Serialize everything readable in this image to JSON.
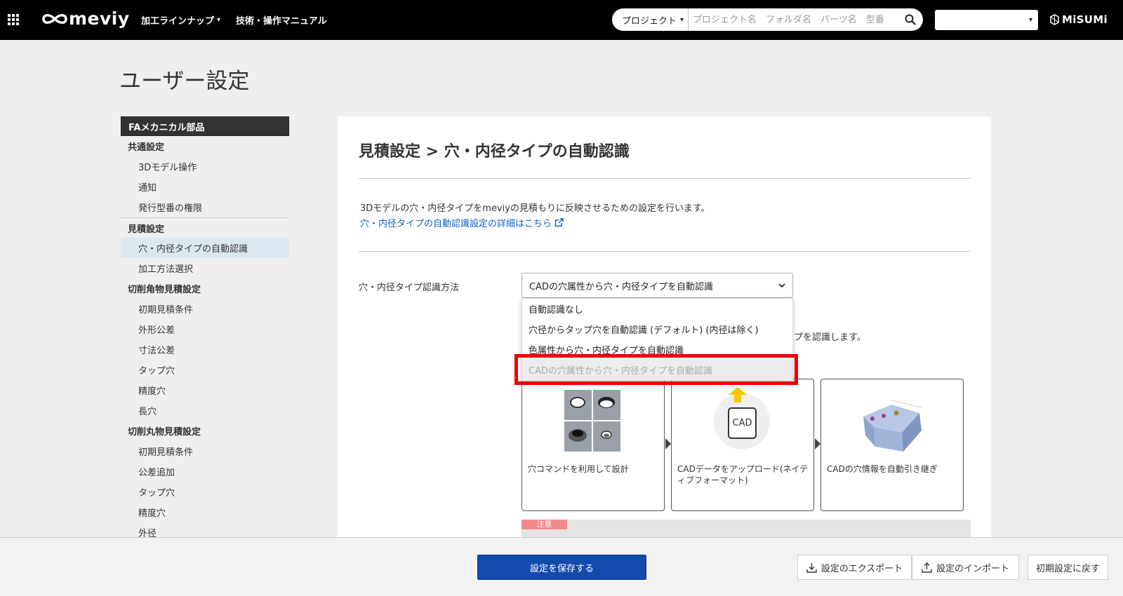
{
  "header": {
    "logo_text": "meviy",
    "nav": [
      {
        "label": "加工ラインナップ",
        "has_dropdown": true
      },
      {
        "label": "技術・操作マニュアル",
        "has_dropdown": false
      }
    ],
    "search": {
      "scope_label": "プロジェクト",
      "placeholder": "プロジェクト名　フォルダ名　パーツ名　型番"
    },
    "account_select_value": "",
    "brand": "MiSUMi"
  },
  "page": {
    "title": "ユーザー設定"
  },
  "sidebar": {
    "header": "FAメカニカル部品",
    "groups": [
      {
        "label": "共通設定",
        "items": [
          "3Dモデル操作",
          "通知",
          "発行型番の権限"
        ]
      },
      {
        "label": "見積設定",
        "items": [
          "穴・内径タイプの自動認識",
          "加工方法選択"
        ]
      },
      {
        "label": "切削角物見積設定",
        "items": [
          "初期見積条件",
          "外形公差",
          "寸法公差",
          "タップ穴",
          "精度穴",
          "長穴"
        ]
      },
      {
        "label": "切削丸物見積設定",
        "items": [
          "初期見積条件",
          "公差追加",
          "タップ穴",
          "精度穴",
          "外径"
        ]
      }
    ],
    "active_item": "穴・内径タイプの自動認識"
  },
  "main": {
    "title": "見積設定 > 穴・内径タイプの自動認識",
    "description": "3Dモデルの穴・内径タイプをmeviyの見積もりに反映させるための設定を行います。",
    "link_text": "穴・内径タイプの自動認識設定の詳細はこちら",
    "field_label": "穴・内径タイプ認識方法",
    "select_value": "CADの穴属性から穴・内径タイプを自動認識",
    "options": [
      "自動認識なし",
      "穴径からタップ穴を自動認識 (デフォルト) (内径は除く)",
      "色属性から穴・内径タイプを自動認識",
      "CADの穴属性から穴・内径タイプを自動認識"
    ],
    "hint_text": "プを認識します。",
    "cards": [
      {
        "text": "穴コマンドを利用して設計",
        "image": "hole-types-image"
      },
      {
        "text": "CADデータをアップロード(ネイティブフォーマット)",
        "image": "cad-file-icon",
        "icon_text": "CAD"
      },
      {
        "text": "CADの穴情報を自動引き継ぎ",
        "image": "cube-model-image"
      }
    ],
    "note_tag": "注意"
  },
  "footer": {
    "save_label": "設定を保存する",
    "export_label": "設定のエクスポート",
    "import_label": "設定のインポート",
    "reset_label": "初期設定に戻す"
  },
  "colors": {
    "header_bg": "#000000",
    "primary_button": "#1449ad",
    "link": "#1560bd",
    "highlight": "#ee0000",
    "active_item_bg": "#dce8ef"
  }
}
